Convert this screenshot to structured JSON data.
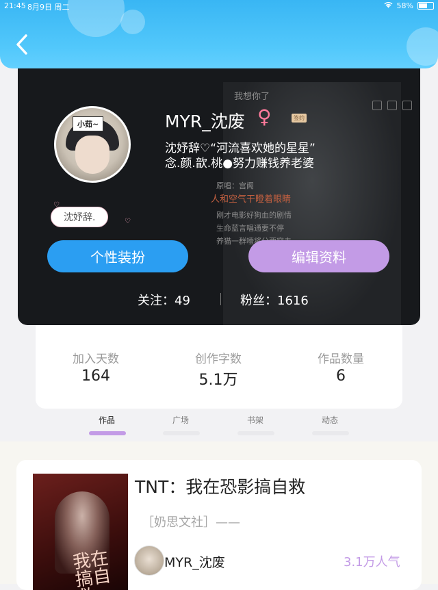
{
  "status_bar": {
    "time": "21:45",
    "date": "8月9日 周二",
    "battery": "58%"
  },
  "background_text": {
    "line1": "我想你了",
    "line2": "原唱：宫阁",
    "line3": "人和空气干瞪着眼睛",
    "line4": "刚才电影好狗血的剧情",
    "line5": "生命蓝言唱通要不停",
    "line6": "养猫一群噎将分要穿去"
  },
  "profile": {
    "avatar_tag": "小茹~",
    "username": "MYR_沈废",
    "gender_symbol": "♀",
    "signed_badge": "签约",
    "bio_line1": "沈妤辞♡“河流喜欢她的星星”",
    "bio_line2": "念.颜.歆.桃●努力赚钱养老婆",
    "nickname_tag": "沈妤辞.",
    "button_personalize": "个性装扮",
    "button_edit": "编辑资料",
    "following": "关注：49",
    "followers": "粉丝：1616"
  },
  "stats": [
    {
      "label": "加入天数",
      "value": "164"
    },
    {
      "label": "创作字数",
      "value": "5.1万"
    },
    {
      "label": "作品数量",
      "value": "6"
    }
  ],
  "tabs": [
    {
      "label": "作品",
      "active": true
    },
    {
      "label": "广场",
      "active": false
    },
    {
      "label": "书架",
      "active": false
    },
    {
      "label": "动态",
      "active": false
    }
  ],
  "book": {
    "title": "TNT：我在恐影搞自救",
    "category": "［奶思文社］——",
    "author": "MYR_沈废",
    "popularity": "3.1万人气",
    "cover_text": "我在搞自救"
  },
  "colors": {
    "header_blue": "#39b6f4",
    "button_blue": "#2b9ef2",
    "accent_purple": "#c39be6",
    "female_pink": "#ff7b9c"
  }
}
